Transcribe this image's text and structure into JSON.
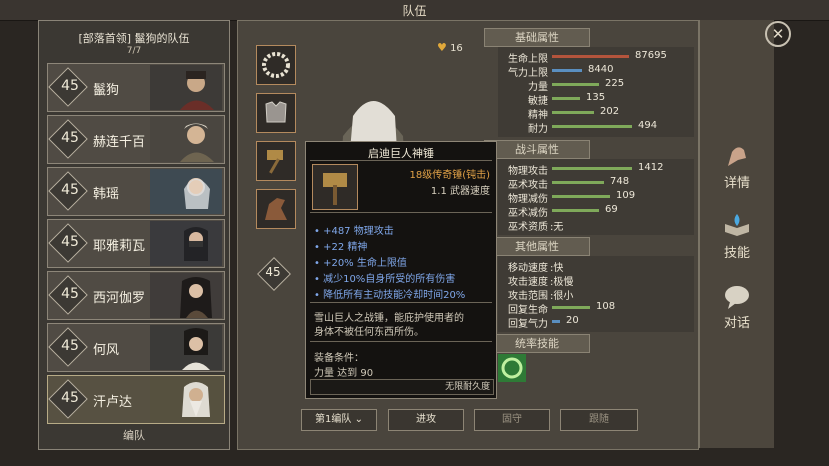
{
  "window": {
    "title": "队伍"
  },
  "team": {
    "name": "[部落首领] 鬣狗的队伍",
    "count": "7/7",
    "bottom_label": "编队",
    "heroes": [
      {
        "level": "45",
        "name": "鬣狗"
      },
      {
        "level": "45",
        "name": "赫连千百"
      },
      {
        "level": "45",
        "name": "韩瑶"
      },
      {
        "level": "45",
        "name": "耶雅莉瓦"
      },
      {
        "level": "45",
        "name": "西河伽罗"
      },
      {
        "level": "45",
        "name": "何风"
      },
      {
        "level": "45",
        "name": "汗卢达"
      }
    ]
  },
  "character": {
    "level": "45",
    "gold": "16"
  },
  "sections": {
    "basic": "基础属性",
    "combat": "战斗属性",
    "other": "其他属性",
    "command": "统率技能"
  },
  "basic_stats": [
    {
      "label": "生命上限",
      "value": "87695",
      "fill": 0.82,
      "color": "#b4543c"
    },
    {
      "label": "气力上限",
      "value": "8440",
      "fill": 0.32,
      "color": "#5a8fc0"
    },
    {
      "label": "力量",
      "value": "225",
      "fill": 0.5,
      "color": "#7fa95a"
    },
    {
      "label": "敏捷",
      "value": "135",
      "fill": 0.3,
      "color": "#7fa95a"
    },
    {
      "label": "精神",
      "value": "202",
      "fill": 0.45,
      "color": "#7fa95a"
    },
    {
      "label": "耐力",
      "value": "494",
      "fill": 0.85,
      "color": "#7fa95a"
    }
  ],
  "combat_stats": [
    {
      "label": "物理攻击",
      "value": "1412",
      "fill": 0.85,
      "color": "#7fa95a"
    },
    {
      "label": "巫术攻击",
      "value": "748",
      "fill": 0.55,
      "color": "#7fa95a"
    },
    {
      "label": "物理减伤",
      "value": "109",
      "fill": 0.62,
      "color": "#7fa95a"
    },
    {
      "label": "巫术减伤",
      "value": "69",
      "fill": 0.5,
      "color": "#7fa95a"
    },
    {
      "label": "巫术资质",
      "value": "无"
    }
  ],
  "other_stats": [
    {
      "label": "移动速度",
      "value": "快"
    },
    {
      "label": "攻击速度",
      "value": "极慢"
    },
    {
      "label": "攻击范围",
      "value": "很小"
    },
    {
      "label": "回复生命",
      "value": "108",
      "fill": 0.4,
      "color": "#7fa95a"
    },
    {
      "label": "回复气力",
      "value": "20",
      "fill": 0.08,
      "color": "#5a8fc0"
    }
  ],
  "buttons": {
    "formation": "第1编队",
    "attack": "进攻",
    "defend": "固守",
    "follow": "跟随"
  },
  "side_tabs": {
    "details": "详情",
    "skills": "技能",
    "dialogue": "对话"
  },
  "tooltip": {
    "title": "启迪巨人神锤",
    "rarity": "18级传奇锤(钝击)",
    "speed": "1.1 武器速度",
    "effects": [
      "+487 物理攻击",
      "+22 精神",
      "+20% 生命上限值",
      "减少10%自身所受的所有伤害",
      "降低所有主动技能冷却时间20%"
    ],
    "description_1": "雪山巨人之战锤，能庇护使用者的",
    "description_2": "身体不被任何东西所伤。",
    "req_label": "装备条件：",
    "req_value": "力量 达到 90",
    "durability": "无限耐久度"
  },
  "colors": {
    "accent": "#e2a247",
    "effect_blue": "#7fa7ea"
  },
  "icons": [
    "close-icon",
    "gold-heart-icon",
    "necklace-icon",
    "armor-icon",
    "hammer-icon",
    "horse-icon",
    "arm-icon",
    "book-icon",
    "chat-icon",
    "dropdown-icon"
  ]
}
